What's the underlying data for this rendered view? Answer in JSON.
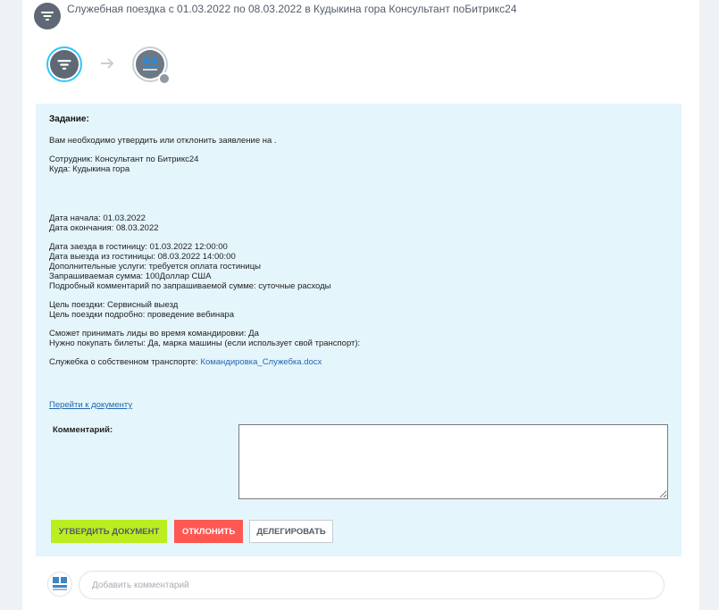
{
  "header": {
    "title": "Служебная поездка с 01.03.2022 по 08.03.2022 в Кудыкина гора Консультант поБитрикс24",
    "avatar_icon": "filter-icon"
  },
  "workflow": {
    "step1_icon": "filter-icon",
    "arrow_icon": "arrow-right-icon",
    "step2_icon": "company-logo-icon",
    "step2_badge_icon": "clock-icon"
  },
  "task": {
    "title": "Задание:",
    "intro": "Вам необходимо утвердить или отклонить заявление на .",
    "employee": "Сотрудник: Консультант по Битрикс24",
    "destination": "Куда: Кудыкина гора",
    "start_date": "Дата начала: 01.03.2022",
    "end_date": "Дата окончания: 08.03.2022",
    "checkin": "Дата заезда в гостиницу: 01.03.2022 12:00:00",
    "checkout": "Дата выезда из гостиницы: 08.03.2022 14:00:00",
    "extra_services": "Дополнительные услуги: требуется оплата гостиницы",
    "requested_amount": "Запрашиваемая сумма: 100Доллар США",
    "amount_comment": "Подробный комментарий по запрашиваемой сумме: суточные расходы",
    "purpose": "Цель поездки: Сервисный выезд",
    "purpose_detail": "Цель поездки подробно: проведение вебинара",
    "leads": "Сможет принимать лиды во время командировки: Да",
    "tickets": "Нужно покупать билеты: Да, марка машины (если использует свой транспорт):",
    "memo_label": "Служебка о собственном транспорте: ",
    "memo_file": "Командировка_Служебка.docx",
    "doc_link": "Перейти к документу",
    "comment_label": "Комментарий:",
    "comment_value": ""
  },
  "buttons": {
    "approve": "Утвердить документ",
    "reject": "Отклонить",
    "delegate": "Делегировать"
  },
  "footer": {
    "comment_placeholder": "Добавить комментарий",
    "avatar_icon": "company-logo-icon"
  },
  "colors": {
    "accent_blue": "#2fc6f6",
    "approve_green": "#bbed21",
    "reject_red": "#ff5752",
    "task_bg": "#e5f5fc",
    "link": "#2067b0"
  }
}
